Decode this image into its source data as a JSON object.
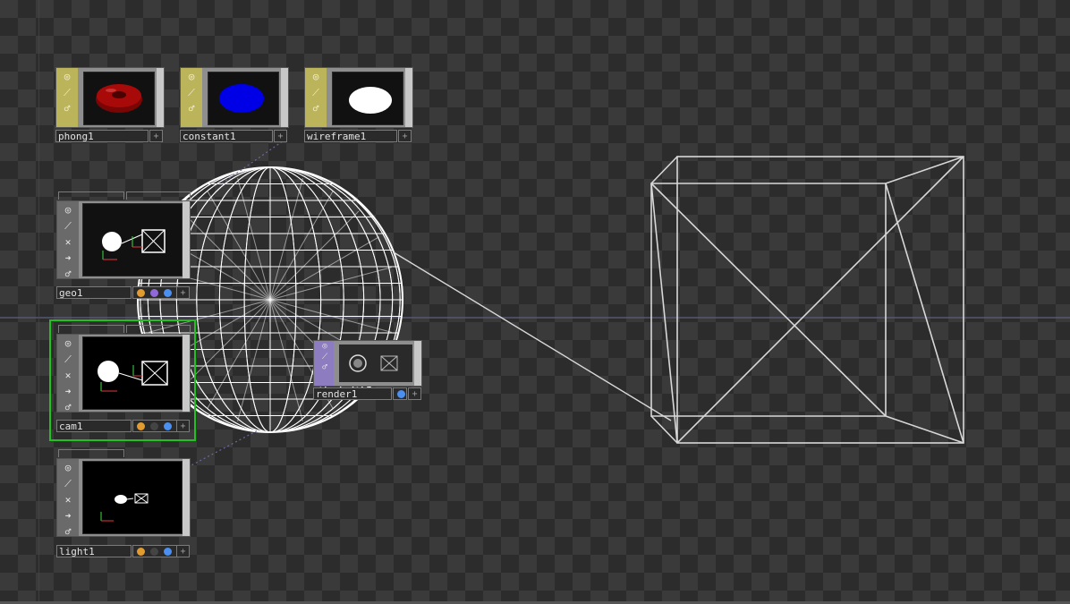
{
  "nodes": {
    "phong": {
      "label": "phong1",
      "preview": "red-torus"
    },
    "constant": {
      "label": "constant1",
      "preview": "blue-disc"
    },
    "wireframe": {
      "label": "wireframe1",
      "preview": "white-disc"
    },
    "geo": {
      "label": "geo1"
    },
    "cam": {
      "label": "cam1",
      "selected": true
    },
    "light": {
      "label": "light1"
    },
    "render": {
      "label": "render1"
    }
  },
  "icons": [
    "viewer-toggle-icon",
    "bypass-icon",
    "lock-icon",
    "clone-icon",
    "display-icon",
    "render-flag-icon",
    "plus-icon"
  ],
  "colors": {
    "mat_side": "#bcb45a",
    "comp_side": "#6a6a6a",
    "top_side": "#8d7cbf",
    "selected": "#21c21d",
    "flag_orange": "#e29b2e",
    "flag_purple": "#9068d8",
    "flag_blue": "#4b8ff0",
    "phong_torus": "#a80a0a",
    "constant_disc": "#0000e6"
  }
}
